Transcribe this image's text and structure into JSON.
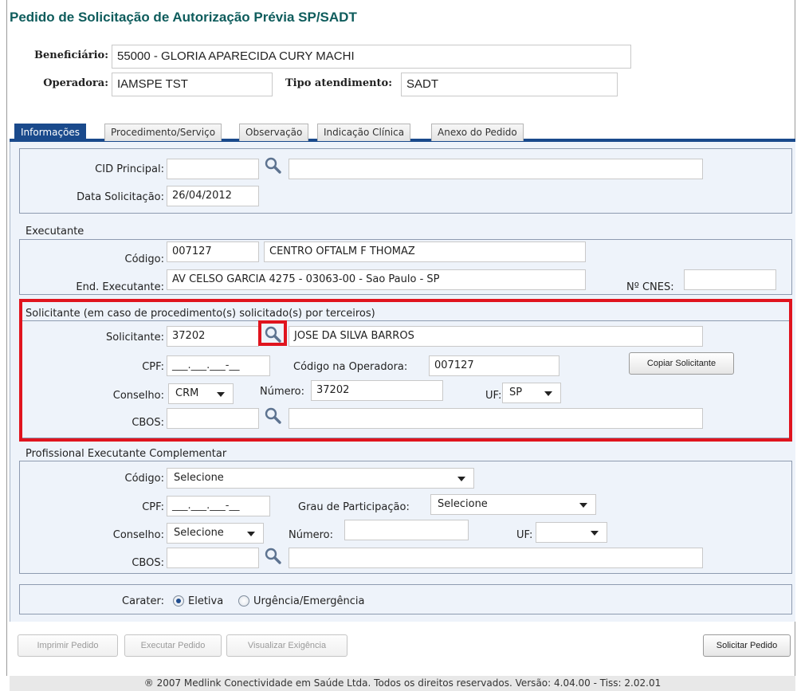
{
  "page": {
    "title": "Pedido de Solicitação de Autorização Prévia SP/SADT"
  },
  "header": {
    "beneficiario_label": "Beneficiário:",
    "beneficiario_value": "55000 - GLORIA APARECIDA CURY MACHI",
    "operadora_label": "Operadora:",
    "operadora_value": "IAMSPE TST",
    "tipo_label": "Tipo atendimento:",
    "tipo_value": "SADT"
  },
  "tabs": [
    {
      "label": "Informações",
      "active": true
    },
    {
      "label": "Procedimento/Serviço",
      "active": false
    },
    {
      "label": "Observação",
      "active": false
    },
    {
      "label": "Indicação Clínica",
      "active": false
    },
    {
      "label": "Anexo do Pedido",
      "active": false
    }
  ],
  "info": {
    "cid_label": "CID Principal:",
    "cid_value": "",
    "cid_desc": "",
    "data_label": "Data Solicitação:",
    "data_value": "26/04/2012"
  },
  "executante": {
    "section_title": "Executante",
    "codigo_label": "Código:",
    "codigo_value": "007127",
    "nome_value": "CENTRO OFTALM F THOMAZ",
    "end_label": "End. Executante:",
    "end_value": "AV CELSO GARCIA 4275 - 03063-00 - Sao Paulo - SP",
    "cnes_label": "Nº CNES:",
    "cnes_value": ""
  },
  "solicitante": {
    "section_title": "Solicitante (em caso de procedimento(s) solicitado(s) por terceiros)",
    "solicitante_label": "Solicitante:",
    "solicitante_value": "37202",
    "solicitante_nome": "JOSE DA SILVA BARROS",
    "cpf_label": "CPF:",
    "cpf_value": "___.___.___-__",
    "codop_label": "Código na Operadora:",
    "codop_value": "007127",
    "copiar_button": "Copiar Solicitante",
    "conselho_label": "Conselho:",
    "conselho_value": "CRM",
    "numero_label": "Número:",
    "numero_value": "37202",
    "uf_label": "UF:",
    "uf_value": "SP",
    "cbos_label": "CBOS:",
    "cbos_value": "",
    "cbos_desc": ""
  },
  "complementar": {
    "section_title": "Profissional Executante Complementar",
    "codigo_label": "Código:",
    "codigo_value": "Selecione",
    "cpf_label": "CPF:",
    "cpf_value": "___.___.___-__",
    "grau_label": "Grau de Participação:",
    "grau_value": "Selecione",
    "conselho_label": "Conselho:",
    "conselho_value": "Selecione",
    "numero_label": "Número:",
    "numero_value": "",
    "uf_label": "UF:",
    "uf_value": "",
    "cbos_label": "CBOS:",
    "cbos_value": "",
    "cbos_desc": ""
  },
  "carater": {
    "label": "Carater:",
    "option1": "Eletiva",
    "option2": "Urgência/Emergência",
    "selected": "Eletiva"
  },
  "actions": {
    "imprimir": "Imprimir Pedido",
    "executar": "Executar Pedido",
    "visualizar": "Visualizar Exigência",
    "solicitar": "Solicitar Pedido"
  },
  "footer": {
    "text": "® 2007 Medlink Conectividade em Saúde Ltda. Todos os direitos reservados. Versão: 4.04.00 - Tiss: 2.02.01"
  },
  "colors": {
    "title": "#0e5c5c",
    "tab_active": "#1a4a8c",
    "panel_bg": "#eef3fa",
    "highlight": "#e0141e"
  },
  "icons": {
    "lookup": "search-icon"
  }
}
